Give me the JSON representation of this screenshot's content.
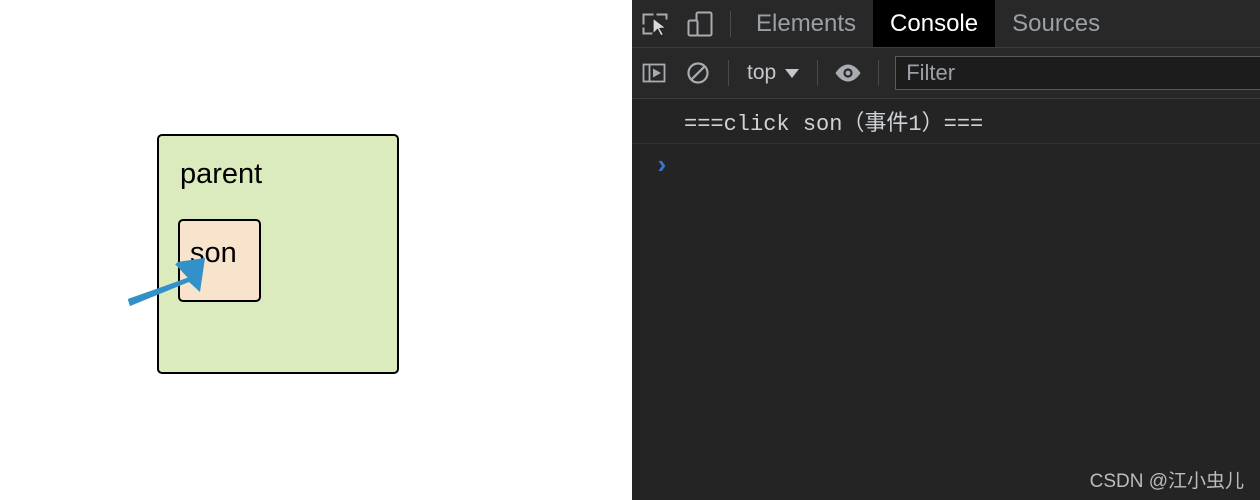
{
  "webpage": {
    "parent_box": {
      "label": "parent",
      "bg_color": "#dcebbd",
      "border_color": "#000000"
    },
    "son_box": {
      "label": "son",
      "bg_color": "#f8e4cc",
      "border_color": "#000000"
    },
    "cursor": {
      "icon": "arrow-pointer",
      "color": "#3291c8"
    }
  },
  "devtools": {
    "tabbar": {
      "inspect_icon": "inspect-element-icon",
      "device_icon": "device-toolbar-icon",
      "tabs": [
        {
          "label": "Elements",
          "active": false
        },
        {
          "label": "Console",
          "active": true
        },
        {
          "label": "Sources",
          "active": false
        }
      ]
    },
    "console_toolbar": {
      "sidebar_icon": "console-sidebar-icon",
      "clear_icon": "clear-console-icon",
      "context": {
        "value": "top",
        "caret_icon": "chevron-down-icon"
      },
      "eye_icon": "live-expression-eye-icon",
      "filter": {
        "placeholder": "Filter",
        "value": ""
      }
    },
    "console_output": {
      "messages": [
        {
          "text": "===click son（事件1）==="
        }
      ],
      "prompt": {
        "chevron": "›",
        "value": ""
      }
    },
    "watermark": "CSDN @江小虫儿",
    "colors": {
      "panel_bg": "#242424",
      "toolbar_bg": "#282828",
      "active_tab_bg": "#000000",
      "text": "#a8abb0",
      "prompt_blue": "#3b74d6"
    }
  }
}
